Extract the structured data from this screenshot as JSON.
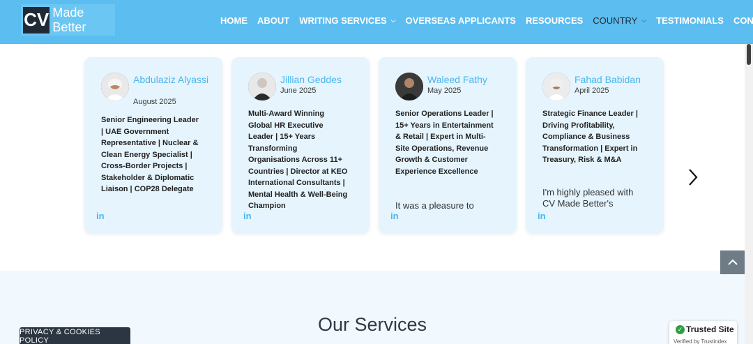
{
  "header": {
    "logo_mark": "CV",
    "logo_text": "Made Better",
    "nav": [
      {
        "label": "HOME"
      },
      {
        "label": "ABOUT"
      },
      {
        "label": "WRITING SERVICES"
      },
      {
        "label": "OVERSEAS APPLICANTS"
      },
      {
        "label": "RESOURCES"
      },
      {
        "label": "COUNTRY"
      },
      {
        "label": "TESTIMONIALS"
      },
      {
        "label": "CONTACT"
      }
    ]
  },
  "testimonials": [
    {
      "name": "Abdulaziz Alyassi",
      "date": "August 2025",
      "headline": "Senior Engineering Leader | UAE Government Representative | Nuclear & Clean Energy Specialist | Cross-Border Projects | Stakeholder & Diplomatic Liaison | COP28 Delegate",
      "quote": "",
      "social": "in"
    },
    {
      "name": "Jillian Geddes",
      "date": "June 2025",
      "headline": "Multi-Award Winning Global HR Executive Leader | 15+ Years Transforming Organisations Across 11+ Countries | Director at KEO International Consultants | Mental Health & Well-Being Champion",
      "quote": "",
      "social": "in"
    },
    {
      "name": "Waleed Fathy",
      "date": "May 2025",
      "headline": "Senior Operations Leader | 15+ Years in Entertainment & Retail | Expert in Multi-Site Operations, Revenue Growth & Customer Experience Excellence",
      "quote": "It was a pleasure to",
      "social": "in"
    },
    {
      "name": "Fahad Babidan",
      "date": "April 2025",
      "headline": "Strategic Finance Leader | Driving Profitability, Compliance & Business Transformation | Expert in Treasury, Risk & M&A",
      "quote": "I'm highly pleased with CV Made Better's",
      "social": "in"
    }
  ],
  "services": {
    "title": "Our Services"
  },
  "privacy": {
    "label": "PRIVACY & COOKIES POLICY"
  },
  "trust": {
    "title": "Trusted Site",
    "subtitle": "Verified by Trustindex"
  },
  "colors": {
    "header": "#5bbdf0",
    "accent": "#4ab6ee",
    "card": "#e5f4fd"
  }
}
